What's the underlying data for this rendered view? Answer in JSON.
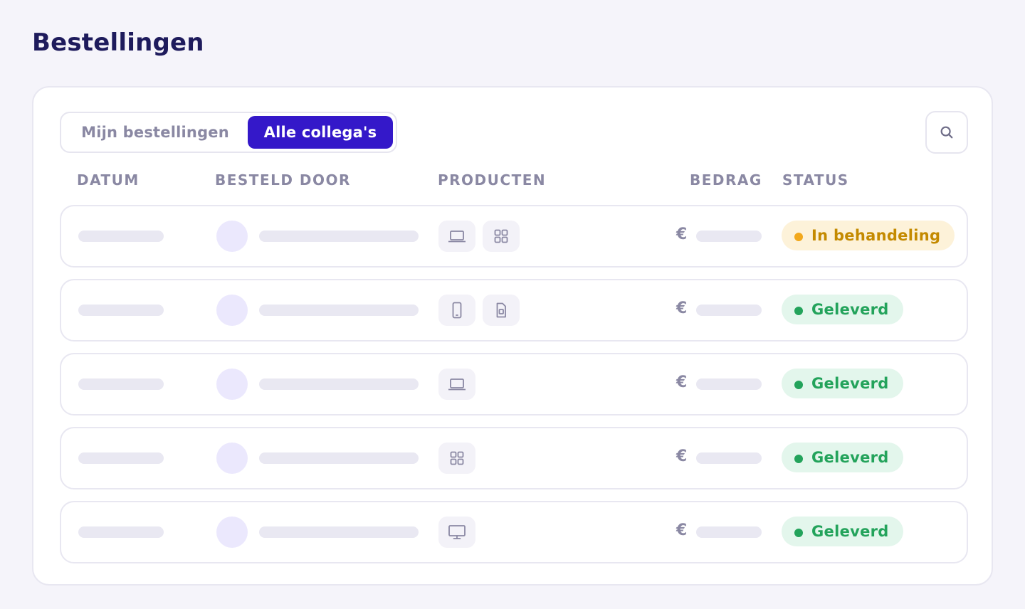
{
  "page": {
    "title": "Bestellingen"
  },
  "tabs": {
    "mine": "Mijn bestellingen",
    "all": "Alle collega's",
    "active": "all"
  },
  "search": {
    "icon": "search-icon"
  },
  "columns": {
    "date": "DATUM",
    "ordered_by": "BESTELD DOOR",
    "products": "PRODUCTEN",
    "amount": "BEDRAG",
    "status": "STATUS"
  },
  "currency_symbol": "€",
  "colors": {
    "accent": "#3418c9",
    "title": "#1e1b5c",
    "pending_text": "#c48a00",
    "pending_bg": "#fdf2d9",
    "delivered_text": "#23a35b",
    "delivered_bg": "#e3f6ec"
  },
  "orders": [
    {
      "products": [
        "laptop-icon",
        "grid-icon"
      ],
      "status": "In behandeling",
      "status_type": "pending"
    },
    {
      "products": [
        "phone-icon",
        "sim-card-icon"
      ],
      "status": "Geleverd",
      "status_type": "delivered"
    },
    {
      "products": [
        "laptop-icon"
      ],
      "status": "Geleverd",
      "status_type": "delivered"
    },
    {
      "products": [
        "grid-icon"
      ],
      "status": "Geleverd",
      "status_type": "delivered"
    },
    {
      "products": [
        "monitor-icon"
      ],
      "status": "Geleverd",
      "status_type": "delivered"
    }
  ]
}
